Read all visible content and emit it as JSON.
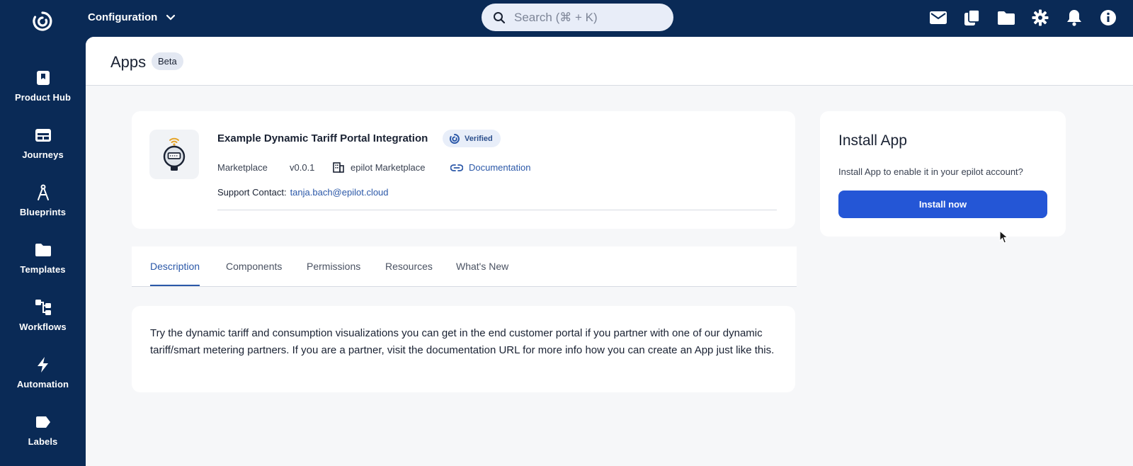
{
  "topbar": {
    "context_label": "Configuration",
    "search_placeholder": "Search (⌘ + K)",
    "icons": [
      "mail-icon",
      "copy-icon",
      "folder-icon",
      "gear-icon",
      "bell-icon",
      "info-icon"
    ]
  },
  "sidebar": {
    "items": [
      {
        "label": "Product Hub",
        "icon": "bookmark-icon"
      },
      {
        "label": "Journeys",
        "icon": "browser-window-icon"
      },
      {
        "label": "Blueprints",
        "icon": "compass-icon"
      },
      {
        "label": "Templates",
        "icon": "folder-icon"
      },
      {
        "label": "Workflows",
        "icon": "flow-icon"
      },
      {
        "label": "Automation",
        "icon": "lightning-icon"
      },
      {
        "label": "Labels",
        "icon": "tag-icon"
      }
    ]
  },
  "page": {
    "title": "Apps",
    "badge": "Beta"
  },
  "app": {
    "name": "Example Dynamic Tariff Portal Integration",
    "verified_label": "Verified",
    "source": "Marketplace",
    "version": "v0.0.1",
    "publisher": "epilot Marketplace",
    "documentation_label": "Documentation",
    "support_label": "Support Contact:",
    "support_email": "tanja.bach@epilot.cloud"
  },
  "install": {
    "title": "Install App",
    "description": "Install App to enable it in your epilot account?",
    "button_label": "Install now"
  },
  "tabs": [
    {
      "label": "Description",
      "active": true
    },
    {
      "label": "Components",
      "active": false
    },
    {
      "label": "Permissions",
      "active": false
    },
    {
      "label": "Resources",
      "active": false
    },
    {
      "label": "What's New",
      "active": false
    }
  ],
  "description": {
    "text": "Try the dynamic tariff and consumption visualizations you can get in the end customer portal if you partner with one of our dynamic tariff/smart metering partners. If you are a partner, visit the documentation URL for more info how you can create an App just like this."
  },
  "colors": {
    "brand_navy": "#0a2a56",
    "primary_button": "#2456d6",
    "link": "#2b58a8"
  }
}
